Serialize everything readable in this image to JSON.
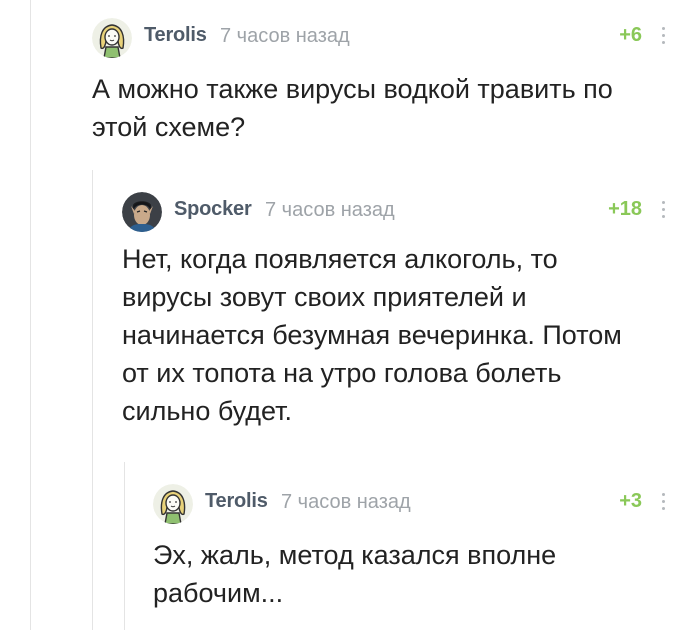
{
  "comments": [
    {
      "author": "Terolis",
      "time": "7 часов назад",
      "rating": "+6",
      "avatar": "girl-avatar-icon",
      "text_lines": [
        "А можно также вирусы водкой травить по",
        "этой схеме?"
      ]
    },
    {
      "author": "Spocker",
      "time": "7 часов назад",
      "rating": "+18",
      "avatar": "spock-avatar-icon",
      "text_lines": [
        "Нет, когда появляется алкоголь, то",
        "вирусы зовут своих приятелей и",
        "начинается безумная вечеринка. Потом",
        "от их топота на утро голова болеть",
        "сильно будет."
      ]
    },
    {
      "author": "Terolis",
      "time": "7 часов назад",
      "rating": "+3",
      "avatar": "girl-avatar-icon",
      "text_lines": [
        "Эх, жаль, метод казался вполне",
        "рабочим..."
      ]
    }
  ],
  "colors": {
    "author": "#4f5b69",
    "time": "#9ea3a8",
    "rating_positive": "#8ac858",
    "thread_line": "#e4e4e4"
  }
}
